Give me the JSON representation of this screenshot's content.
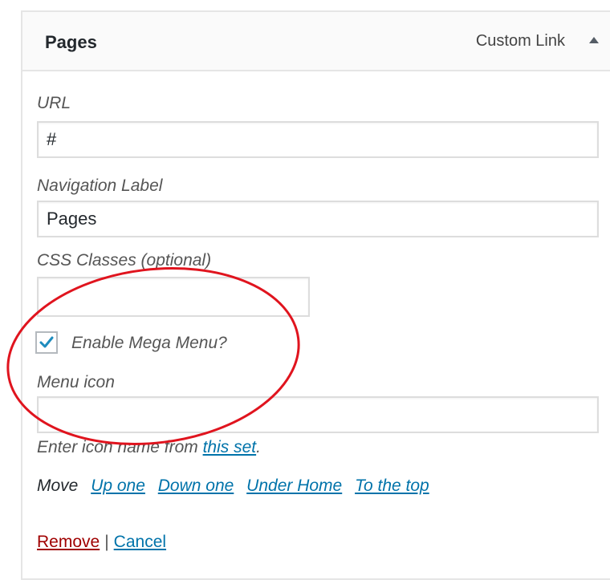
{
  "menu_item": {
    "title": "Pages",
    "type": "Custom Link",
    "toggle_icon": "arrow-up-icon"
  },
  "fields": {
    "url": {
      "label": "URL",
      "value": "#"
    },
    "nav_label": {
      "label": "Navigation Label",
      "value": "Pages"
    },
    "css_classes": {
      "label": "CSS Classes (optional)",
      "value": ""
    },
    "mega_menu": {
      "label": "Enable Mega Menu?",
      "checked": true
    },
    "menu_icon": {
      "label": "Menu icon",
      "value": "",
      "help_prefix": "Enter icon name from ",
      "help_link": "this set",
      "help_suffix": "."
    }
  },
  "move": {
    "label": "Move",
    "options": [
      "Up one",
      "Down one",
      "Under Home",
      "To the top"
    ]
  },
  "actions": {
    "remove": "Remove",
    "separator": "|",
    "cancel": "Cancel"
  },
  "colors": {
    "link": "#0073aa",
    "remove": "#a00000",
    "annotation": "#e0141e",
    "checkmark": "#1e8cbe"
  }
}
